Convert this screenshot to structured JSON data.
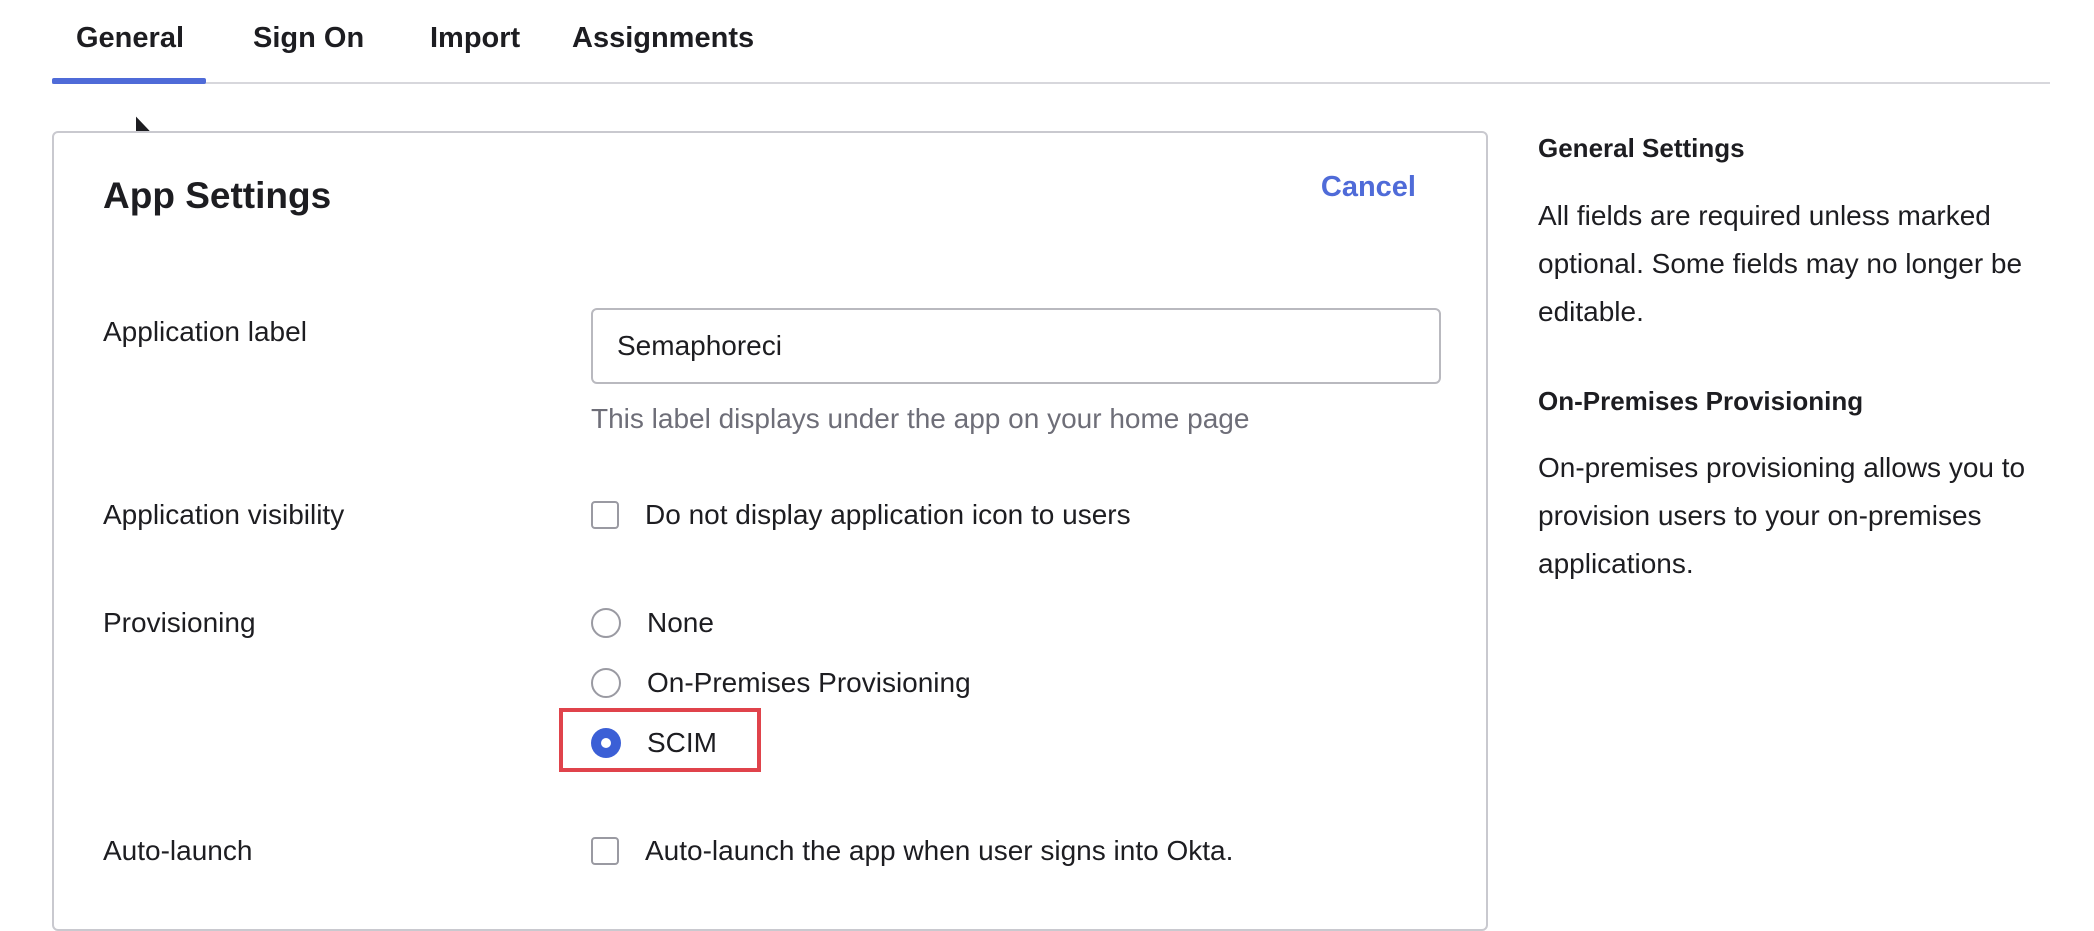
{
  "tabs": [
    {
      "label": "General",
      "active": true
    },
    {
      "label": "Sign On",
      "active": false
    },
    {
      "label": "Import",
      "active": false
    },
    {
      "label": "Assignments",
      "active": false
    }
  ],
  "card": {
    "title": "App Settings",
    "cancel_label": "Cancel",
    "application_label": {
      "label": "Application label",
      "value": "Semaphoreci",
      "help": "This label displays under the app on your home page"
    },
    "application_visibility": {
      "label": "Application visibility",
      "option": "Do not display application icon to users",
      "checked": false
    },
    "provisioning": {
      "label": "Provisioning",
      "options": [
        "None",
        "On-Premises Provisioning",
        "SCIM"
      ],
      "selected": "SCIM"
    },
    "auto_launch": {
      "label": "Auto-launch",
      "option": "Auto-launch the app when user signs into Okta.",
      "checked": false
    }
  },
  "side_panel": {
    "general_heading": "General Settings",
    "general_text": "All fields are required unless marked optional. Some fields may no longer be editable.",
    "onprem_heading": "On-Premises Provisioning",
    "onprem_text": "On-premises provisioning allows you to provision users to your on-premises applications."
  },
  "colors": {
    "accent": "#4f6bd8",
    "radio_selected": "#3b5fd6",
    "highlight": "#e0434b"
  }
}
